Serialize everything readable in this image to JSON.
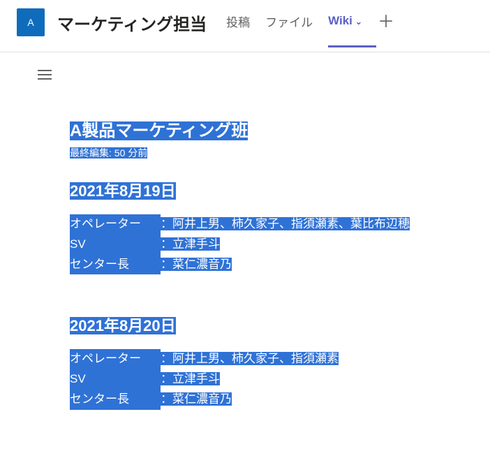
{
  "header": {
    "avatar_initial": "A",
    "channel_name": "マーケティング担当",
    "tabs": {
      "posts": "投稿",
      "files": "ファイル",
      "wiki": "Wiki"
    }
  },
  "wiki": {
    "page_title": "A製品マーケティング班",
    "last_edit": "最終編集: 50 分前",
    "sections": [
      {
        "heading": "2021年8月19日",
        "rows": [
          {
            "label": "オペレーター",
            "value": "：阿井上男、柿久家子、指須瀬素、葉比布辺穂"
          },
          {
            "label": "SV",
            "value": "：立津手斗"
          },
          {
            "label": "センター長",
            "value": "：菜仁濃音乃"
          }
        ]
      },
      {
        "heading": "2021年8月20日",
        "rows": [
          {
            "label": "オペレーター",
            "value": "：阿井上男、柿久家子、指須瀬素"
          },
          {
            "label": "SV",
            "value": "：立津手斗"
          },
          {
            "label": "センター長",
            "value": "：菜仁濃音乃"
          }
        ]
      }
    ]
  }
}
